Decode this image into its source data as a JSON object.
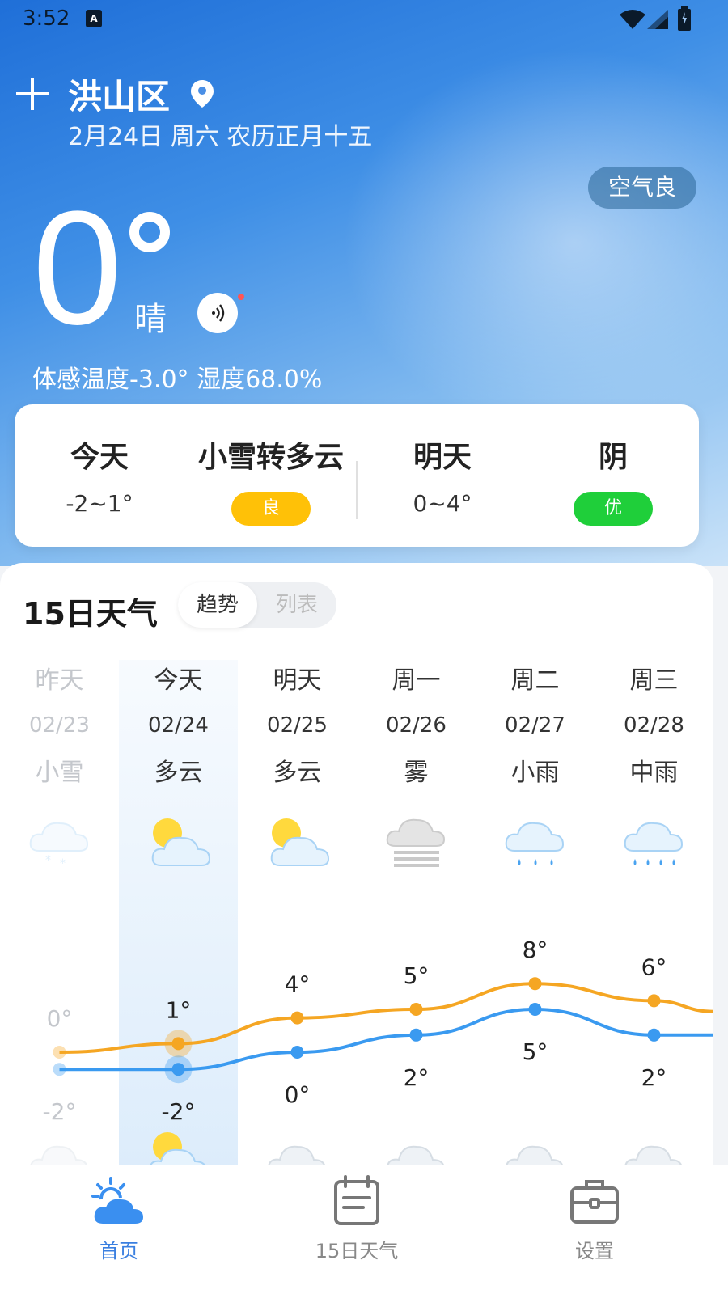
{
  "status": {
    "time": "3:52",
    "kb_badge": "A"
  },
  "header": {
    "city": "洪山区",
    "date": "2月24日 周六 农历正月十五",
    "aqi_pill": "空气良"
  },
  "current": {
    "temp": "0",
    "condition": "晴",
    "feels_like": "体感温度-3.0° 湿度68.0%"
  },
  "summary": {
    "today_label": "今天",
    "today_range": "-2~1°",
    "today_condition": "小雪转多云",
    "today_aqi": "良",
    "tomorrow_label": "明天",
    "tomorrow_range": "0~4°",
    "tomorrow_condition": "阴",
    "tomorrow_aqi": "优",
    "colors": {
      "good": "#ffc107",
      "excellent": "#1fcf3a"
    }
  },
  "forecast": {
    "title": "15日天气",
    "toggle": {
      "trend": "趋势",
      "list": "列表"
    },
    "days": [
      {
        "name": "昨天",
        "date": "02/23",
        "cond": "小雪",
        "icon": "snow-icon",
        "high": "0°",
        "low": "-2°",
        "night_icon": "cloud-icon"
      },
      {
        "name": "今天",
        "date": "02/24",
        "cond": "多云",
        "icon": "partly-cloudy-icon",
        "high": "1°",
        "low": "-2°",
        "night_icon": "partly-cloudy-icon"
      },
      {
        "name": "明天",
        "date": "02/25",
        "cond": "多云",
        "icon": "partly-cloudy-icon",
        "high": "4°",
        "low": "0°",
        "night_icon": "cloud-icon"
      },
      {
        "name": "周一",
        "date": "02/26",
        "cond": "雾",
        "icon": "fog-icon",
        "high": "5°",
        "low": "2°",
        "night_icon": "cloud-icon"
      },
      {
        "name": "周二",
        "date": "02/27",
        "cond": "小雨",
        "icon": "light-rain-icon",
        "high": "8°",
        "low": "5°",
        "night_icon": "cloud-icon"
      },
      {
        "name": "周三",
        "date": "02/28",
        "cond": "中雨",
        "icon": "moderate-rain-icon",
        "high": "6°",
        "low": "2°",
        "night_icon": "cloud-icon"
      }
    ]
  },
  "chart_data": {
    "type": "line",
    "categories": [
      "02/23",
      "02/24",
      "02/25",
      "02/26",
      "02/27",
      "02/28"
    ],
    "series": [
      {
        "values": [
          0,
          1,
          4,
          5,
          8,
          6
        ],
        "color": "#f5a623"
      },
      {
        "values": [
          -2,
          -2,
          0,
          2,
          5,
          2
        ],
        "color": "#3a9af0"
      }
    ]
  },
  "tabs": [
    {
      "label": "首页",
      "icon": "home-weather-icon"
    },
    {
      "label": "15日天气",
      "icon": "calendar-icon"
    },
    {
      "label": "设置",
      "icon": "toolbox-icon"
    }
  ]
}
